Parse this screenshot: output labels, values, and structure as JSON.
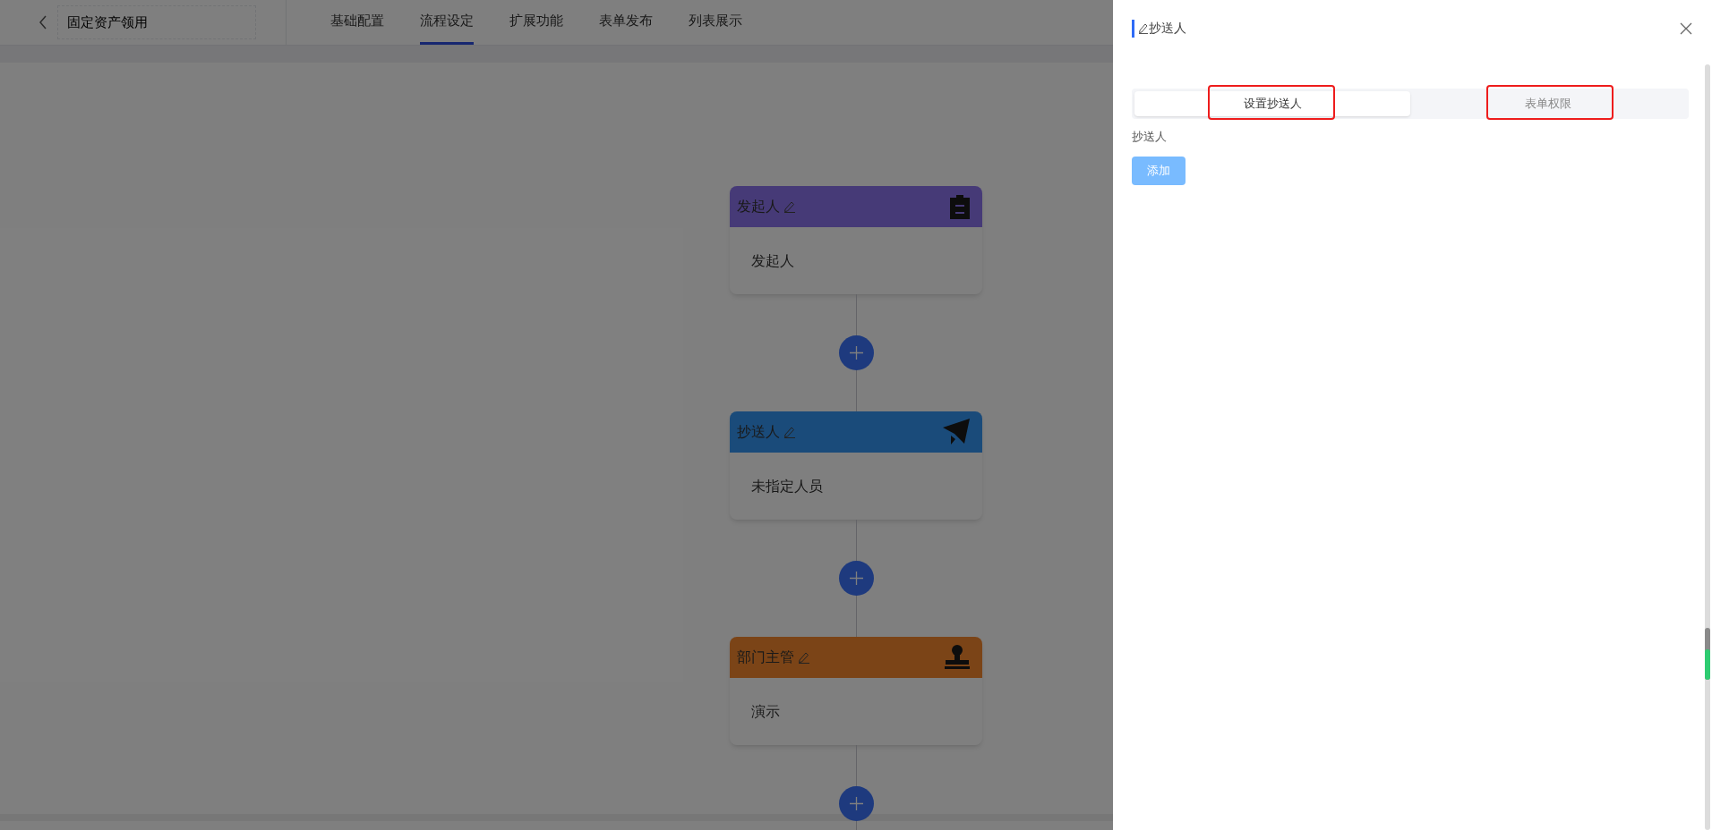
{
  "header": {
    "title": "固定资产领用",
    "tabs": [
      {
        "label": "基础配置",
        "selected": false
      },
      {
        "label": "流程设定",
        "selected": true
      },
      {
        "label": "扩展功能",
        "selected": false
      },
      {
        "label": "表单发布",
        "selected": false
      },
      {
        "label": "列表展示",
        "selected": false
      }
    ]
  },
  "flow": {
    "nodes": [
      {
        "kind": "starter",
        "title": "发起人",
        "body": "发起人"
      },
      {
        "kind": "cc",
        "title": "抄送人",
        "body": "未指定人员"
      },
      {
        "kind": "approver",
        "title": "部门主管",
        "body": "演示"
      }
    ]
  },
  "drawer": {
    "title": "抄送人",
    "tabs": [
      {
        "label": "设置抄送人",
        "selected": true,
        "highlighted": true
      },
      {
        "label": "表单权限",
        "selected": false,
        "highlighted": true
      }
    ],
    "field_label": "抄送人",
    "add_button": "添加"
  }
}
